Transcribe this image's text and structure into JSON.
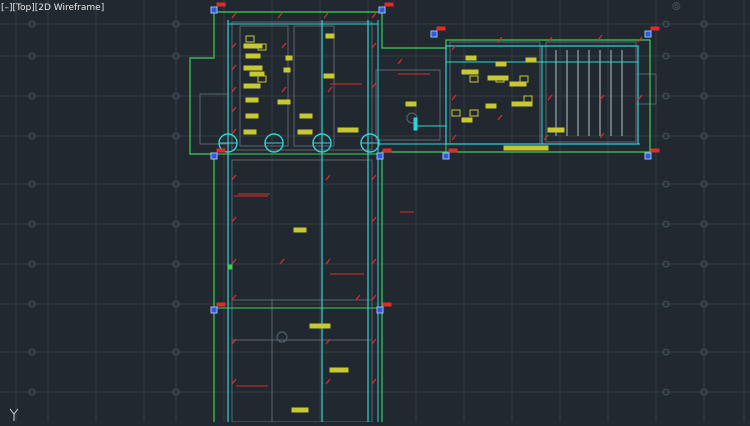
{
  "viewport": {
    "label": "[–][Top][2D Wireframe]",
    "view": "Top",
    "visual_style": "2D Wireframe",
    "ucs_axis": "Y"
  },
  "colors": {
    "background": "#212830",
    "grid": "#323b45",
    "grid_major": "#3b4550",
    "walls": "#5b6570",
    "furniture": "#c8c832",
    "green_outline": "#39d353",
    "cyan_outline": "#2fd6d6",
    "red_markers": "#e02b2b",
    "blue_markers": "#2f5bd6"
  },
  "icons": {
    "ucs": "ucs-axis-icon",
    "column_marker": "column-grid-circle-icon",
    "corner_marker": "blue-corner-grip-icon",
    "tag": "red-tag-icon"
  }
}
